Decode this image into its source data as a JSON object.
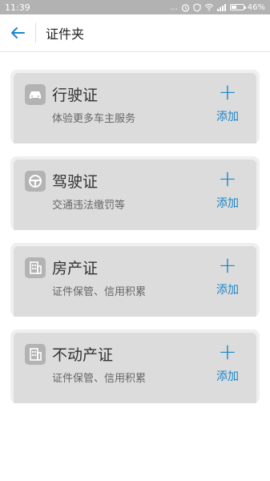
{
  "status_bar": {
    "time": "11:39",
    "dots": "...",
    "battery_percent": "46%",
    "battery_level": 0.46
  },
  "appbar": {
    "title": "证件夹"
  },
  "cards": [
    {
      "title": "行驶证",
      "subtitle": "体验更多车主服务",
      "add_label": "添加",
      "icon": "car-icon"
    },
    {
      "title": "驾驶证",
      "subtitle": "交通违法缴罚等",
      "add_label": "添加",
      "icon": "steering-wheel-icon"
    },
    {
      "title": "房产证",
      "subtitle": "证件保管、信用积累",
      "add_label": "添加",
      "icon": "building-icon"
    },
    {
      "title": "不动产证",
      "subtitle": "证件保管、信用积累",
      "add_label": "添加",
      "icon": "building-icon"
    }
  ],
  "colors": {
    "accent": "#1e86c8",
    "card_bg": "#dcdcdc",
    "status_bar": "#b2b2b2"
  }
}
